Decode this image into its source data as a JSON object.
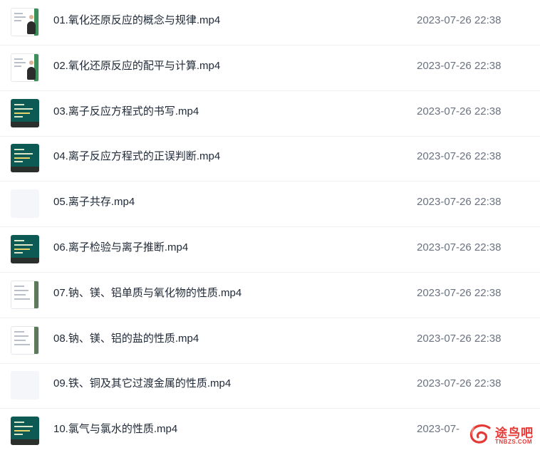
{
  "files": [
    {
      "name": "01.氧化还原反应的概念与规律.mp4",
      "time": "2023-07-26 22:38",
      "thumb": "white-person"
    },
    {
      "name": "02.氧化还原反应的配平与计算.mp4",
      "time": "2023-07-26 22:38",
      "thumb": "white-person"
    },
    {
      "name": "03.离子反应方程式的书写.mp4",
      "time": "2023-07-26 22:38",
      "thumb": "teal"
    },
    {
      "name": "04.离子反应方程式的正误判断.mp4",
      "time": "2023-07-26 22:38",
      "thumb": "teal"
    },
    {
      "name": "05.离子共存.mp4",
      "time": "2023-07-26 22:38",
      "thumb": "empty"
    },
    {
      "name": "06.离子检验与离子推断.mp4",
      "time": "2023-07-26 22:38",
      "thumb": "teal"
    },
    {
      "name": "07.钠、镁、铝单质与氧化物的性质.mp4",
      "time": "2023-07-26 22:38",
      "thumb": "white-doc"
    },
    {
      "name": "08.钠、镁、铝的盐的性质.mp4",
      "time": "2023-07-26 22:38",
      "thumb": "white-doc"
    },
    {
      "name": "09.铁、铜及其它过渡金属的性质.mp4",
      "time": "2023-07-26 22:38",
      "thumb": "empty"
    },
    {
      "name": "10.氯气与氯水的性质.mp4",
      "time": "2023-07-",
      "thumb": "teal"
    }
  ],
  "watermark": {
    "title": "途鸟吧",
    "subtitle": "TNBZS.COM",
    "color": "#e53935"
  }
}
